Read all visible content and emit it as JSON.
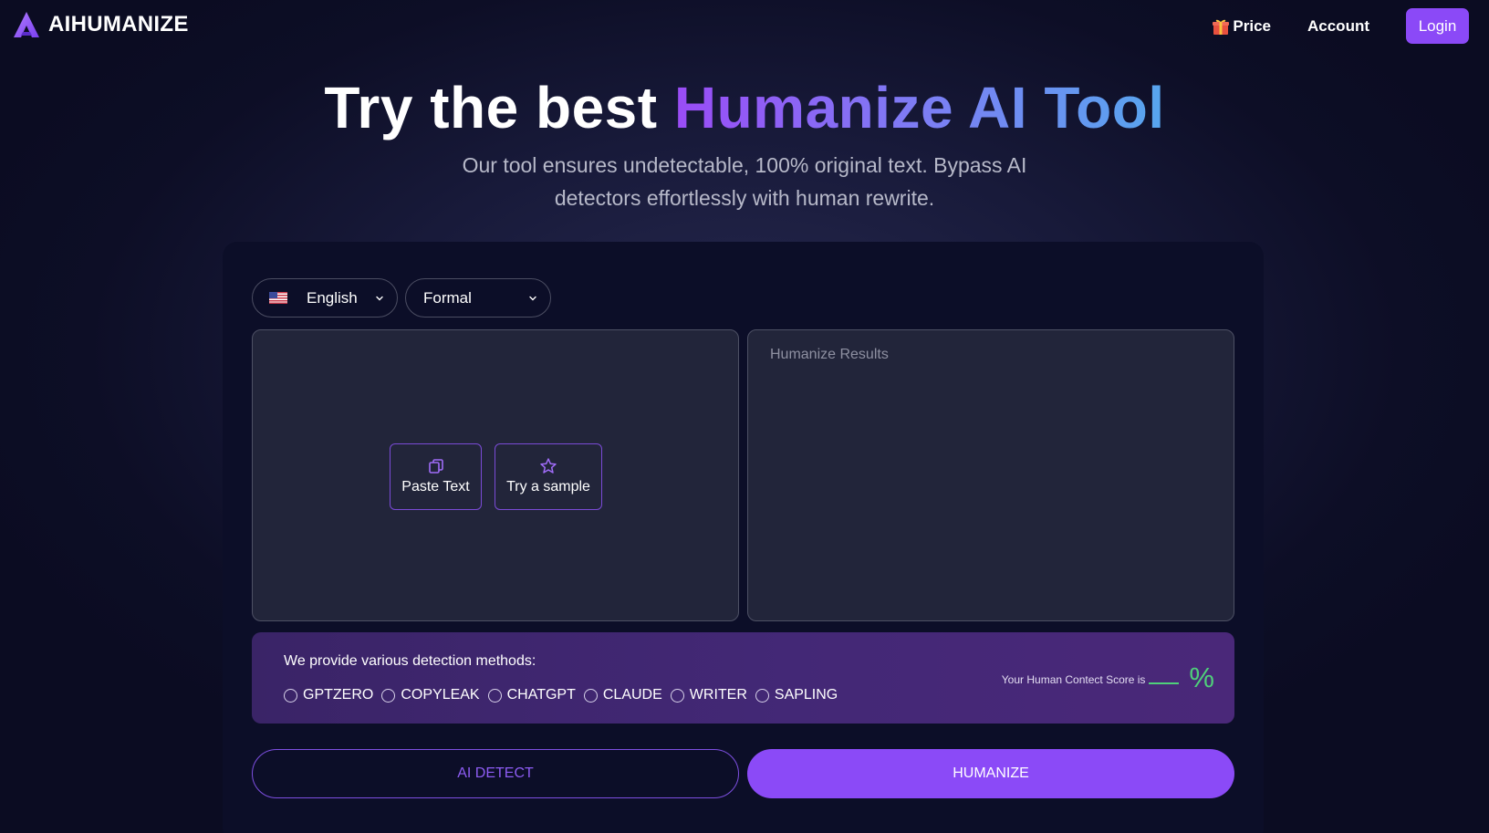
{
  "brand": {
    "name": "AIHUMANIZE",
    "logo_icon": "triangle-a-logo-icon"
  },
  "nav": {
    "price_label": "Price",
    "price_icon": "gift-icon",
    "account_label": "Account",
    "login_label": "Login"
  },
  "hero": {
    "title_prefix": "Try the best ",
    "title_accent": "Humanize AI Tool",
    "subtitle": "Our tool ensures undetectable, 100% original text. Bypass AI detectors effortlessly with human rewrite."
  },
  "controls": {
    "language": {
      "selected": "English",
      "flag_icon": "us-flag-icon"
    },
    "tone": {
      "selected": "Formal"
    }
  },
  "input_panel": {
    "paste_label": "Paste Text",
    "paste_icon": "copy-icon",
    "sample_label": "Try a sample",
    "sample_icon": "star-icon"
  },
  "output_panel": {
    "placeholder": "Humanize Results"
  },
  "detection": {
    "title": "We provide various detection methods:",
    "methods": [
      "GPTZERO",
      "COPYLEAK",
      "CHATGPT",
      "CLAUDE",
      "WRITER",
      "SAPLING"
    ],
    "score_label": "Your Human Contect Score is",
    "score_suffix": "%"
  },
  "actions": {
    "detect_label": "AI DETECT",
    "humanize_label": "HUMANIZE"
  },
  "colors": {
    "accent": "#8b4af7",
    "score": "#4fd07a",
    "background": "#0b0c22",
    "panel": "#22253a"
  }
}
